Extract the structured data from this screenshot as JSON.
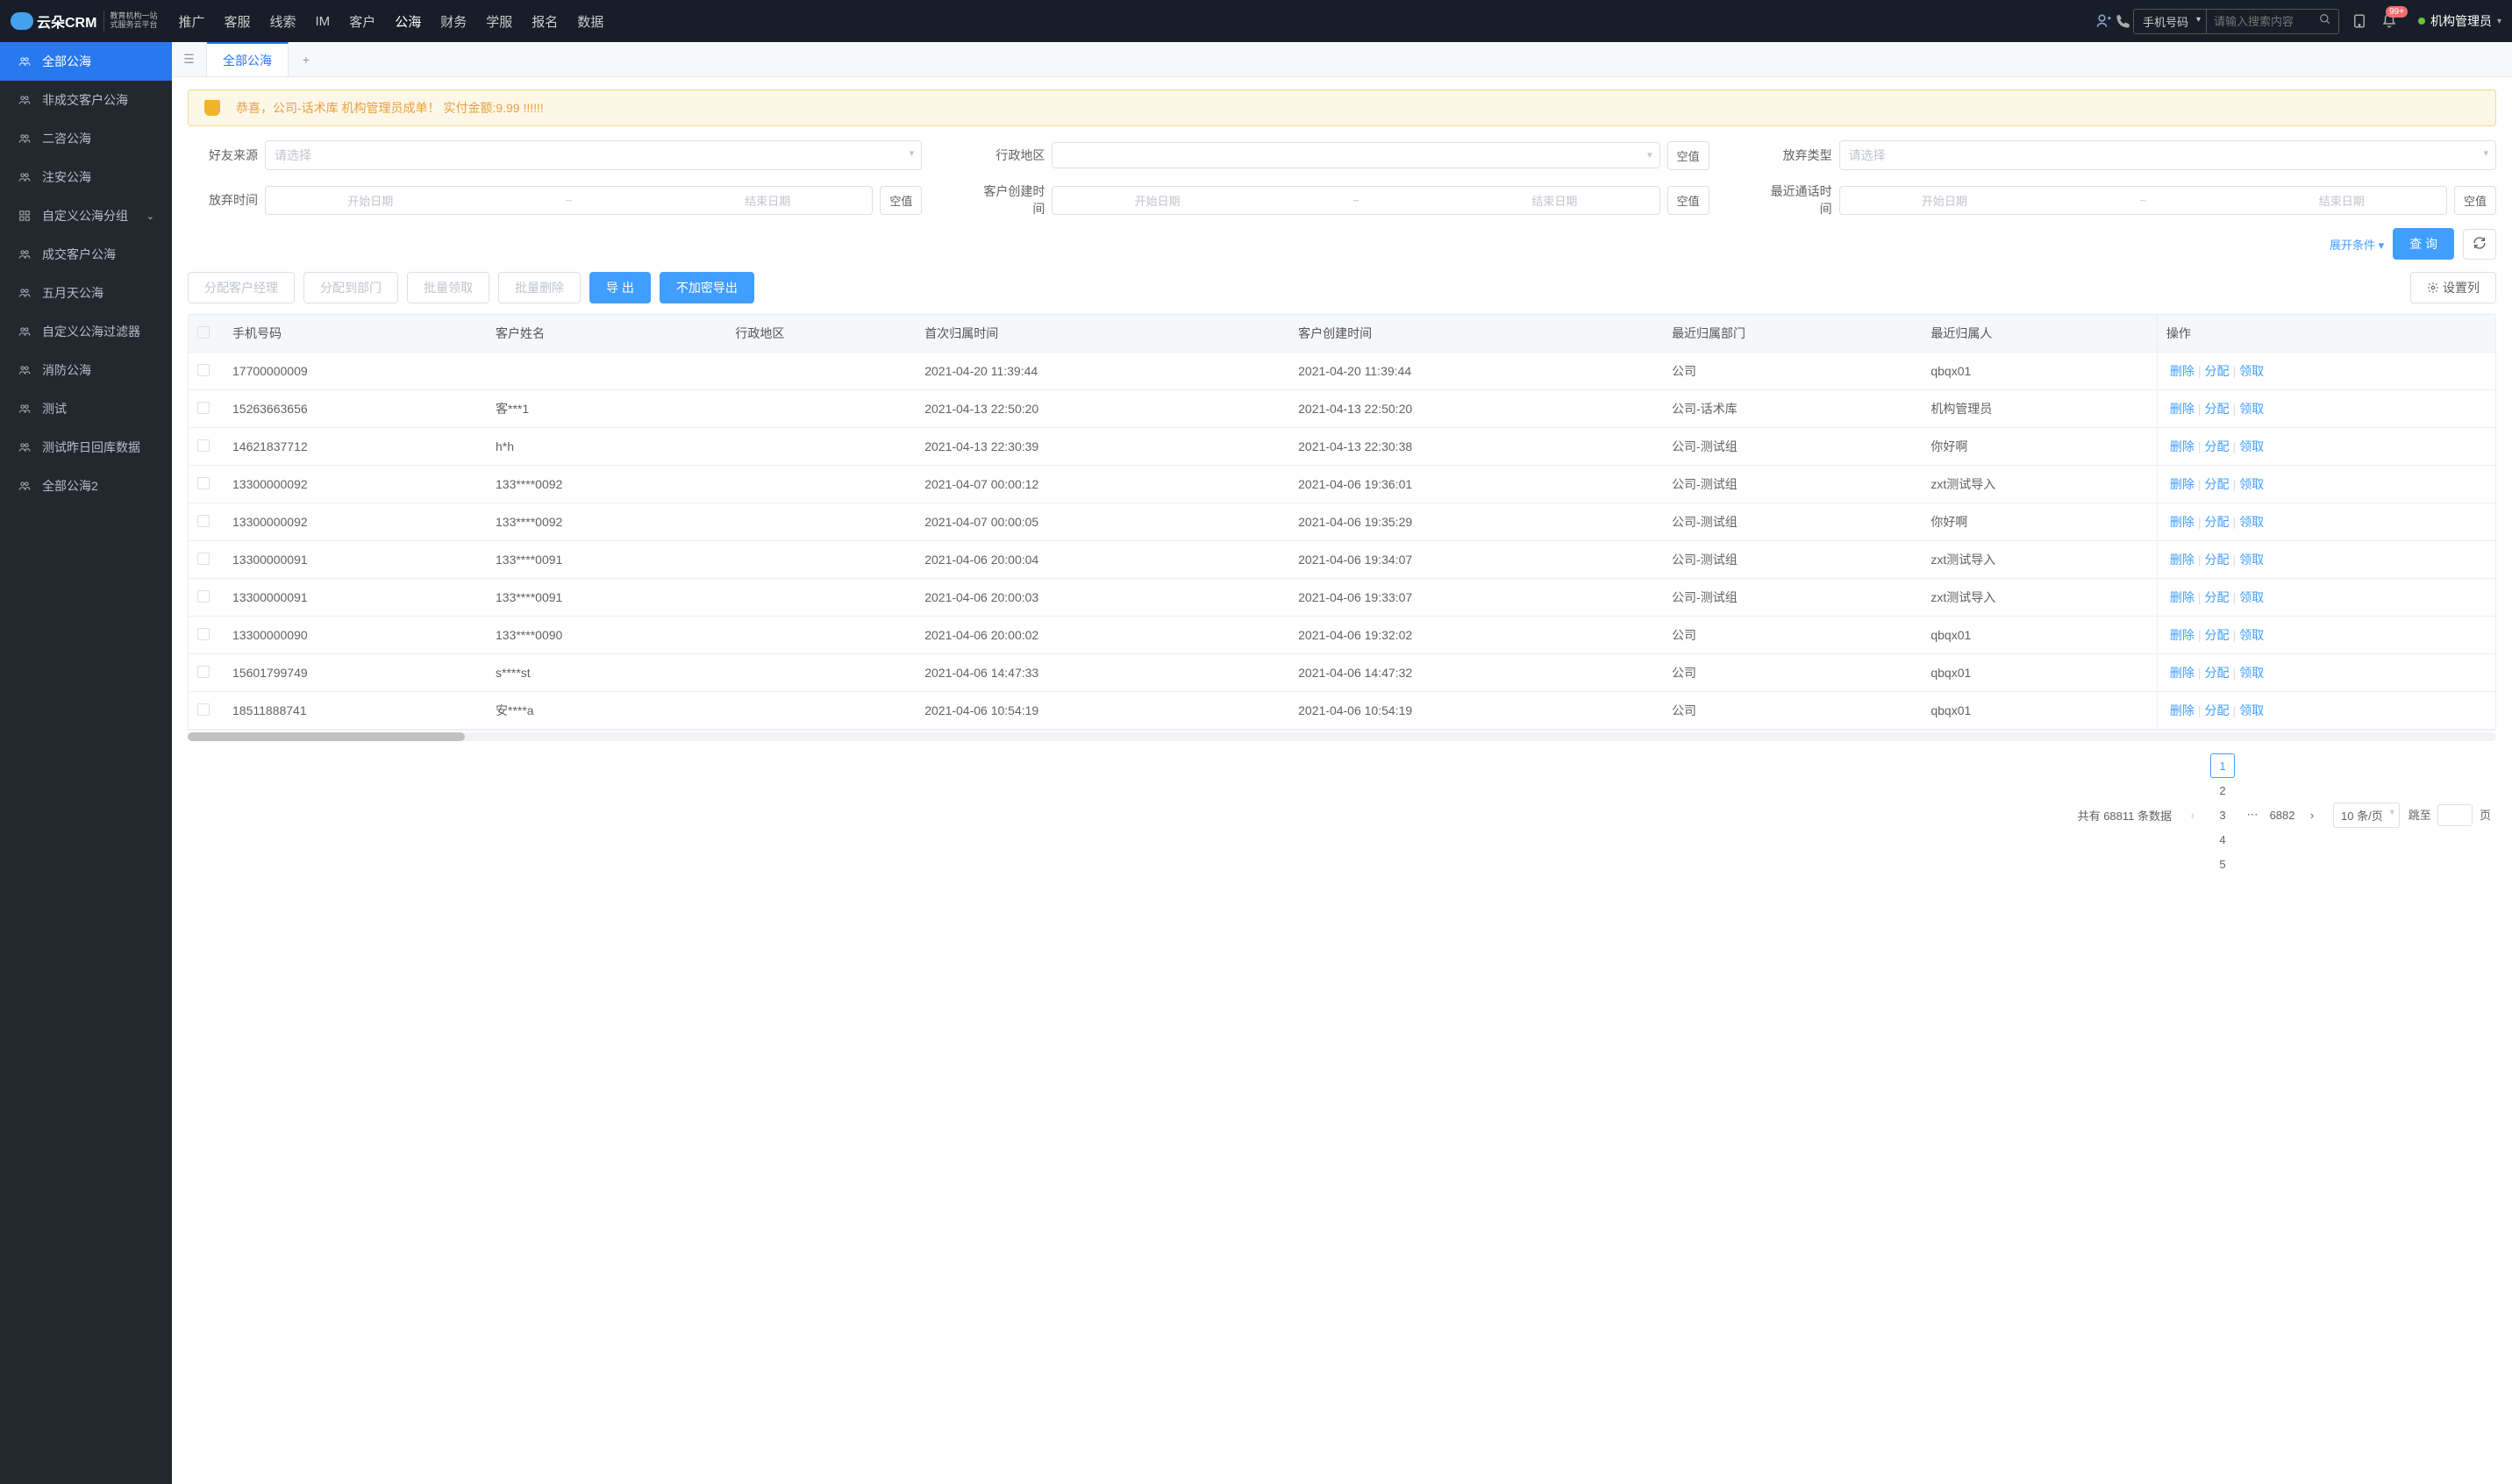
{
  "header": {
    "logo_text": "云朵CRM",
    "logo_sub1": "教育机构一站",
    "logo_sub2": "式服务云平台",
    "nav": [
      "推广",
      "客服",
      "线索",
      "IM",
      "客户",
      "公海",
      "财务",
      "学服",
      "报名",
      "数据"
    ],
    "nav_active_index": 5,
    "search_type": "手机号码",
    "search_placeholder": "请输入搜索内容",
    "notif_count": "99+",
    "user_name": "机构管理员"
  },
  "sidebar": [
    {
      "label": "全部公海",
      "icon": "users",
      "active": true
    },
    {
      "label": "非成交客户公海",
      "icon": "users"
    },
    {
      "label": "二咨公海",
      "icon": "users"
    },
    {
      "label": "注安公海",
      "icon": "users"
    },
    {
      "label": "自定义公海分组",
      "icon": "grid",
      "expandable": true
    },
    {
      "label": "成交客户公海",
      "icon": "users"
    },
    {
      "label": "五月天公海",
      "icon": "users"
    },
    {
      "label": "自定义公海过滤器",
      "icon": "users"
    },
    {
      "label": "消防公海",
      "icon": "users"
    },
    {
      "label": "测试",
      "icon": "users"
    },
    {
      "label": "测试昨日回库数据",
      "icon": "users"
    },
    {
      "label": "全部公海2",
      "icon": "users"
    }
  ],
  "tabs": {
    "active": "全部公海",
    "add_tooltip": "+"
  },
  "banner": "恭喜，公司-话术库  机构管理员成单！  实付金额:9.99 !!!!!!",
  "filters": {
    "row1": [
      {
        "label": "好友来源",
        "type": "select",
        "placeholder": "请选择"
      },
      {
        "label": "行政地区",
        "type": "select",
        "placeholder": "",
        "null_btn": "空值"
      },
      {
        "label": "放弃类型",
        "type": "select",
        "placeholder": "请选择"
      }
    ],
    "row2": [
      {
        "label": "放弃时间",
        "type": "date",
        "start": "开始日期",
        "end": "结束日期",
        "null_btn": "空值"
      },
      {
        "label": "客户创建时间",
        "type": "date",
        "start": "开始日期",
        "end": "结束日期",
        "null_btn": "空值"
      },
      {
        "label": "最近通话时间",
        "type": "date",
        "start": "开始日期",
        "end": "结束日期",
        "null_btn": "空值"
      }
    ],
    "expand_label": "展开条件",
    "query_btn": "查 询",
    "refresh_icon": "↻"
  },
  "toolbar": {
    "assign_manager": "分配客户经理",
    "assign_dept": "分配到部门",
    "batch_claim": "批量领取",
    "batch_delete": "批量删除",
    "export": "导 出",
    "export_plain": "不加密导出",
    "set_columns": "设置列"
  },
  "table": {
    "columns": [
      "手机号码",
      "客户姓名",
      "行政地区",
      "首次归属时间",
      "客户创建时间",
      "最近归属部门",
      "最近归属人",
      "操作"
    ],
    "actions": {
      "delete": "删除",
      "assign": "分配",
      "claim": "领取"
    },
    "rows": [
      {
        "phone": "17700000009",
        "name": "",
        "region": "",
        "first_time": "2021-04-20 11:39:44",
        "create_time": "2021-04-20 11:39:44",
        "dept": "公司",
        "owner": "qbqx01"
      },
      {
        "phone": "15263663656",
        "name": "客***1",
        "region": "",
        "first_time": "2021-04-13 22:50:20",
        "create_time": "2021-04-13 22:50:20",
        "dept": "公司-话术库",
        "owner": "机构管理员"
      },
      {
        "phone": "14621837712",
        "name": "h*h",
        "region": "",
        "first_time": "2021-04-13 22:30:39",
        "create_time": "2021-04-13 22:30:38",
        "dept": "公司-测试组",
        "owner": "你好啊"
      },
      {
        "phone": "13300000092",
        "name": "133****0092",
        "region": "",
        "first_time": "2021-04-07 00:00:12",
        "create_time": "2021-04-06 19:36:01",
        "dept": "公司-测试组",
        "owner": "zxt测试导入"
      },
      {
        "phone": "13300000092",
        "name": "133****0092",
        "region": "",
        "first_time": "2021-04-07 00:00:05",
        "create_time": "2021-04-06 19:35:29",
        "dept": "公司-测试组",
        "owner": "你好啊"
      },
      {
        "phone": "13300000091",
        "name": "133****0091",
        "region": "",
        "first_time": "2021-04-06 20:00:04",
        "create_time": "2021-04-06 19:34:07",
        "dept": "公司-测试组",
        "owner": "zxt测试导入"
      },
      {
        "phone": "13300000091",
        "name": "133****0091",
        "region": "",
        "first_time": "2021-04-06 20:00:03",
        "create_time": "2021-04-06 19:33:07",
        "dept": "公司-测试组",
        "owner": "zxt测试导入"
      },
      {
        "phone": "13300000090",
        "name": "133****0090",
        "region": "",
        "first_time": "2021-04-06 20:00:02",
        "create_time": "2021-04-06 19:32:02",
        "dept": "公司",
        "owner": "qbqx01"
      },
      {
        "phone": "15601799749",
        "name": "s****st",
        "region": "",
        "first_time": "2021-04-06 14:47:33",
        "create_time": "2021-04-06 14:47:32",
        "dept": "公司",
        "owner": "qbqx01"
      },
      {
        "phone": "18511888741",
        "name": "安****a",
        "region": "",
        "first_time": "2021-04-06 10:54:19",
        "create_time": "2021-04-06 10:54:19",
        "dept": "公司",
        "owner": "qbqx01"
      }
    ]
  },
  "pagination": {
    "total_label_prefix": "共有",
    "total": "68811",
    "total_label_suffix": "条数据",
    "pages": [
      "1",
      "2",
      "3",
      "4",
      "5"
    ],
    "last_page": "6882",
    "per_page": "10 条/页",
    "jump_prefix": "跳至",
    "jump_suffix": "页"
  }
}
